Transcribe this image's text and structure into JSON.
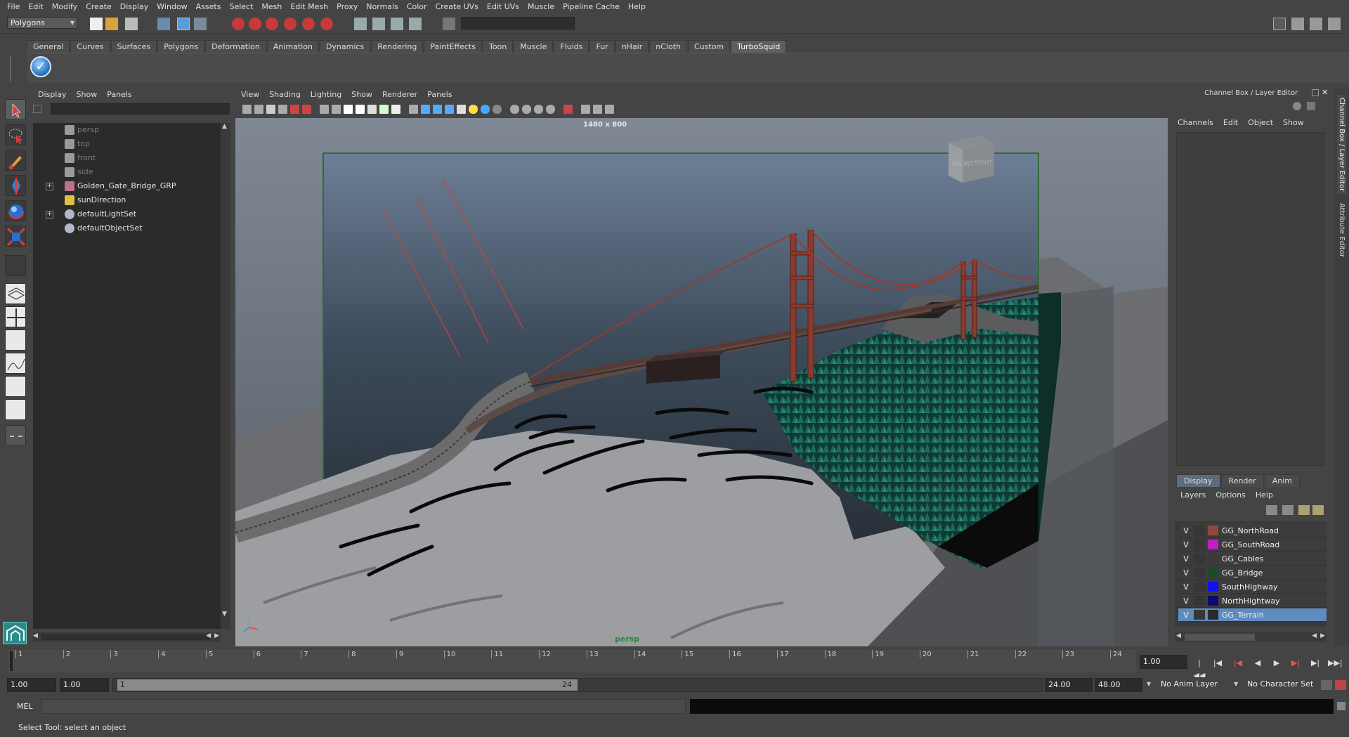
{
  "menubar": [
    "File",
    "Edit",
    "Modify",
    "Create",
    "Display",
    "Window",
    "Assets",
    "Select",
    "Mesh",
    "Edit Mesh",
    "Proxy",
    "Normals",
    "Color",
    "Create UVs",
    "Edit UVs",
    "Muscle",
    "Pipeline Cache",
    "Help"
  ],
  "status_line": {
    "mode": "Polygons"
  },
  "shelf": {
    "tabs": [
      "General",
      "Curves",
      "Surfaces",
      "Polygons",
      "Deformation",
      "Animation",
      "Dynamics",
      "Rendering",
      "PaintEffects",
      "Toon",
      "Muscle",
      "Fluids",
      "Fur",
      "nHair",
      "nCloth",
      "Custom",
      "TurboSquid"
    ],
    "active_tab": "TurboSquid"
  },
  "outliner": {
    "menu": [
      "Display",
      "Show",
      "Panels"
    ],
    "items": [
      {
        "label": "persp",
        "icon": "camera-icon",
        "dim": true
      },
      {
        "label": "top",
        "icon": "camera-icon",
        "dim": true
      },
      {
        "label": "front",
        "icon": "camera-icon",
        "dim": true
      },
      {
        "label": "side",
        "icon": "camera-icon",
        "dim": true
      },
      {
        "label": "Golden_Gate_Bridge_GRP",
        "icon": "group-icon",
        "expandable": true
      },
      {
        "label": "sunDirection",
        "icon": "light-icon"
      },
      {
        "label": "defaultLightSet",
        "icon": "set-icon",
        "expandable": true
      },
      {
        "label": "defaultObjectSet",
        "icon": "set-icon"
      }
    ]
  },
  "viewport": {
    "menu": [
      "View",
      "Shading",
      "Lighting",
      "Show",
      "Renderer",
      "Panels"
    ],
    "resolution": "1480 x 800",
    "camera": "persp",
    "viewcube": {
      "front": "FRONT",
      "right": "RIGHT"
    }
  },
  "channel_box": {
    "title": "Channel Box / Layer Editor",
    "menu": [
      "Channels",
      "Edit",
      "Object",
      "Show"
    ],
    "side_tabs": [
      "Channel Box / Layer Editor",
      "Attribute Editor"
    ]
  },
  "layer_editor": {
    "tabs": [
      "Display",
      "Render",
      "Anim"
    ],
    "active_tab": "Display",
    "menu": [
      "Layers",
      "Options",
      "Help"
    ],
    "layers": [
      {
        "visible": "V",
        "name": "GG_NorthRoad",
        "color": "#8b4a3c"
      },
      {
        "visible": "V",
        "name": "GG_SouthRoad",
        "color": "#c020c0"
      },
      {
        "visible": "V",
        "name": "GG_Cables",
        "color": "#3a3a3a"
      },
      {
        "visible": "V",
        "name": "GG_Bridge",
        "color": "#1a4a2a"
      },
      {
        "visible": "V",
        "name": "SouthHighway",
        "color": "#1010f0"
      },
      {
        "visible": "V",
        "name": "NorthHightway",
        "color": "#0a0a70"
      },
      {
        "visible": "V",
        "name": "GG_Terrain",
        "color": "#2a2a2a",
        "selected": true
      }
    ]
  },
  "time_slider": {
    "ticks": [
      "1",
      "2",
      "3",
      "4",
      "5",
      "6",
      "7",
      "8",
      "9",
      "10",
      "11",
      "12",
      "13",
      "14",
      "15",
      "16",
      "17",
      "18",
      "19",
      "20",
      "21",
      "22",
      "23",
      "24"
    ],
    "current_frame": "1.00"
  },
  "range_slider": {
    "start": "1.00",
    "playback_start": "1.00",
    "range_handle_start": "1",
    "range_handle_end": "24",
    "playback_end": "24.00",
    "end": "48.00",
    "anim_layer": "No Anim Layer",
    "character_set": "No Character Set"
  },
  "command_line": {
    "label": "MEL"
  },
  "help_line": {
    "text": "Select Tool: select an object"
  }
}
